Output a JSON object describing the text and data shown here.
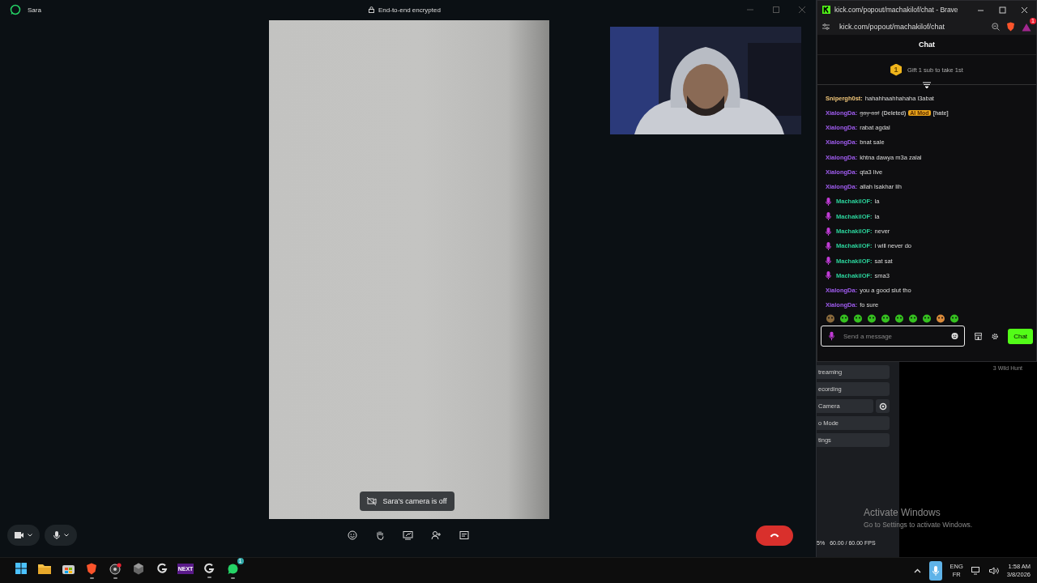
{
  "call_window": {
    "title": "Sara",
    "encryption": "End-to-end encrypted",
    "camera_notice": "Sara's camera is off",
    "camera_on": true,
    "mic_on": true
  },
  "browser": {
    "title": "kick.com/popout/machakilof/chat - Brave",
    "url": "kick.com/popout/machakilof/chat",
    "rewards_badge": "1"
  },
  "chat": {
    "title": "Chat",
    "gift_rank": "1",
    "gift_text": "Gift 1 sub to take 1st",
    "messages": [
      {
        "user": "Snipergh0st:",
        "color": "#f2c77a",
        "mic": false,
        "deleted": false,
        "text": "hahahhaahhahaha l3abat"
      },
      {
        "user": "XialongDa:",
        "color": "#a05cf0",
        "mic": false,
        "deleted": true,
        "text": "gay asf",
        "deleted_label": "(Deleted)",
        "mod_badge": "AI Mod",
        "reason": "[hate]"
      },
      {
        "user": "XialongDa:",
        "color": "#a05cf0",
        "mic": false,
        "deleted": false,
        "text": "rabat agdal"
      },
      {
        "user": "XialongDa:",
        "color": "#a05cf0",
        "mic": false,
        "deleted": false,
        "text": "bnat sale"
      },
      {
        "user": "XialongDa:",
        "color": "#a05cf0",
        "mic": false,
        "deleted": false,
        "text": "khtna dawya m3a zalal"
      },
      {
        "user": "XialongDa:",
        "color": "#a05cf0",
        "mic": false,
        "deleted": false,
        "text": "qta3 live"
      },
      {
        "user": "XialongDa:",
        "color": "#a05cf0",
        "mic": false,
        "deleted": false,
        "text": "allah lsakhar lih"
      },
      {
        "user": "MachakilOF:",
        "color": "#2bd19a",
        "mic": true,
        "deleted": false,
        "text": "la"
      },
      {
        "user": "MachakilOF:",
        "color": "#2bd19a",
        "mic": true,
        "deleted": false,
        "text": "la"
      },
      {
        "user": "MachakilOF:",
        "color": "#2bd19a",
        "mic": true,
        "deleted": false,
        "text": "never"
      },
      {
        "user": "MachakilOF:",
        "color": "#2bd19a",
        "mic": true,
        "deleted": false,
        "text": "i will never do"
      },
      {
        "user": "MachakilOF:",
        "color": "#2bd19a",
        "mic": true,
        "deleted": false,
        "text": "sat sat"
      },
      {
        "user": "MachakilOF:",
        "color": "#2bd19a",
        "mic": true,
        "deleted": false,
        "text": "sma3"
      },
      {
        "user": "XialongDa:",
        "color": "#a05cf0",
        "mic": false,
        "deleted": false,
        "text": "you a good slut tho"
      },
      {
        "user": "XialongDa:",
        "color": "#a05cf0",
        "mic": false,
        "deleted": false,
        "text": "fo sure"
      }
    ],
    "placeholder": "Send a message",
    "send_label": "Chat"
  },
  "obs": {
    "buttons": [
      {
        "label": "treaming",
        "kind": "plain"
      },
      {
        "label": "ecording",
        "kind": "plain"
      },
      {
        "label": "Camera",
        "kind": "gear"
      },
      {
        "label": "o Mode",
        "kind": "plain"
      },
      {
        "label": "tings",
        "kind": "plain"
      }
    ],
    "cpu": "5%",
    "fps": "60.00 / 60.00 FPS",
    "scene": "3 Wild Hunt"
  },
  "activation": {
    "title": "Activate Windows",
    "text": "Go to Settings to activate Windows."
  },
  "taskbar": {
    "apps": [
      {
        "kind": "start",
        "running": false
      },
      {
        "kind": "folder",
        "running": false
      },
      {
        "kind": "store",
        "running": false
      },
      {
        "kind": "brave",
        "running": true
      },
      {
        "kind": "obs",
        "running": true,
        "alert": true
      },
      {
        "kind": "hex",
        "running": false
      },
      {
        "kind": "g",
        "running": false
      },
      {
        "kind": "next",
        "running": false,
        "label": "NEXT"
      },
      {
        "kind": "g",
        "running": true
      },
      {
        "kind": "whatsapp",
        "running": true,
        "badge": "1"
      }
    ],
    "lang": "ENG",
    "layout": "FR",
    "time": "1:58 AM",
    "date": "3/8/2026"
  }
}
